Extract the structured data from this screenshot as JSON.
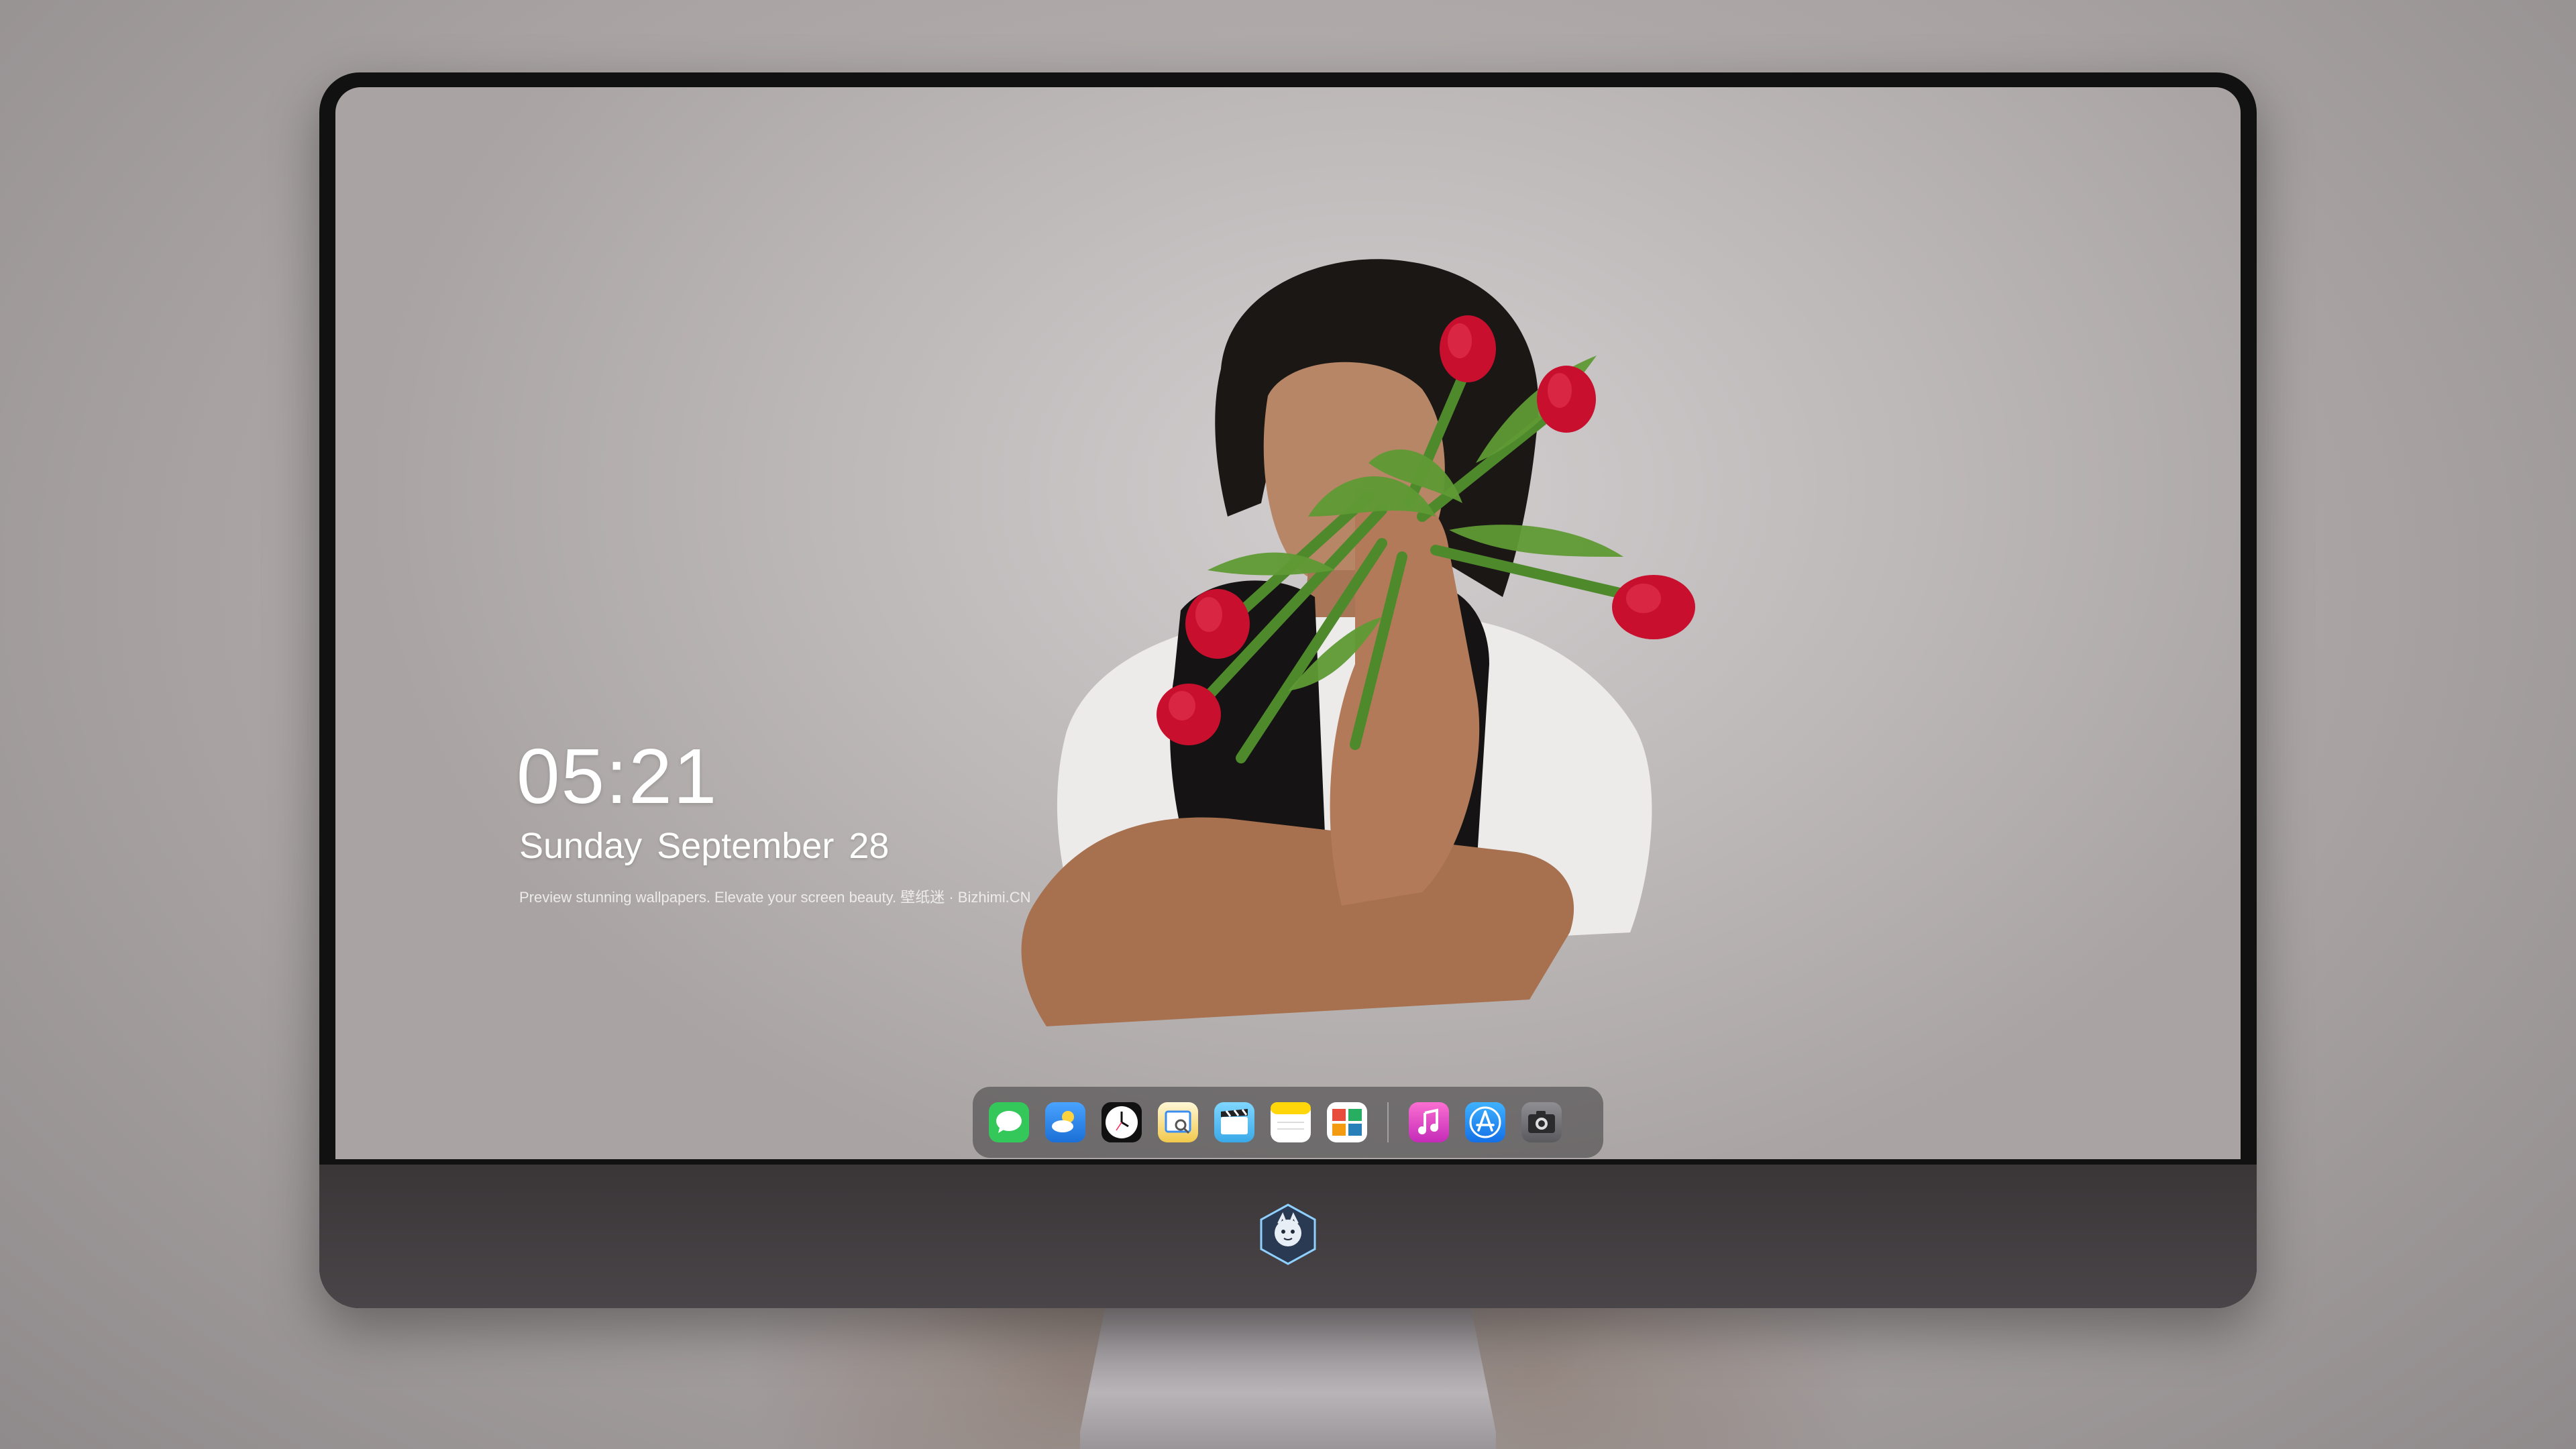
{
  "lockscreen": {
    "time": "05:21",
    "weekday": "Sunday",
    "month": "September",
    "day": "28",
    "tagline": "Preview stunning wallpapers. Elevate your screen beauty. 壁纸迷 · Bizhimi.CN"
  },
  "dock": {
    "apps": [
      {
        "name": "messages-icon",
        "color": "#34c759"
      },
      {
        "name": "weather-icon",
        "color": "#3c8df0"
      },
      {
        "name": "clock-icon",
        "color": "#111111"
      },
      {
        "name": "preview-icon",
        "color": "#f2c94c"
      },
      {
        "name": "clips-icon",
        "color": "#5ac8fa"
      },
      {
        "name": "notes-icon",
        "color": "#ffd60a"
      },
      {
        "name": "photo-booth-icon",
        "color": "#ffffff"
      },
      {
        "name": "music-icon",
        "color": "#f46bd8"
      },
      {
        "name": "app-store-icon",
        "color": "#1e90ff"
      },
      {
        "name": "camera-icon",
        "color": "#6e6e73"
      }
    ]
  },
  "colors": {
    "monitor_bezel": "#111111",
    "monitor_chin": "#3f3b3d",
    "tulip_red": "#c8102e",
    "stem_green": "#4e8a2c"
  }
}
